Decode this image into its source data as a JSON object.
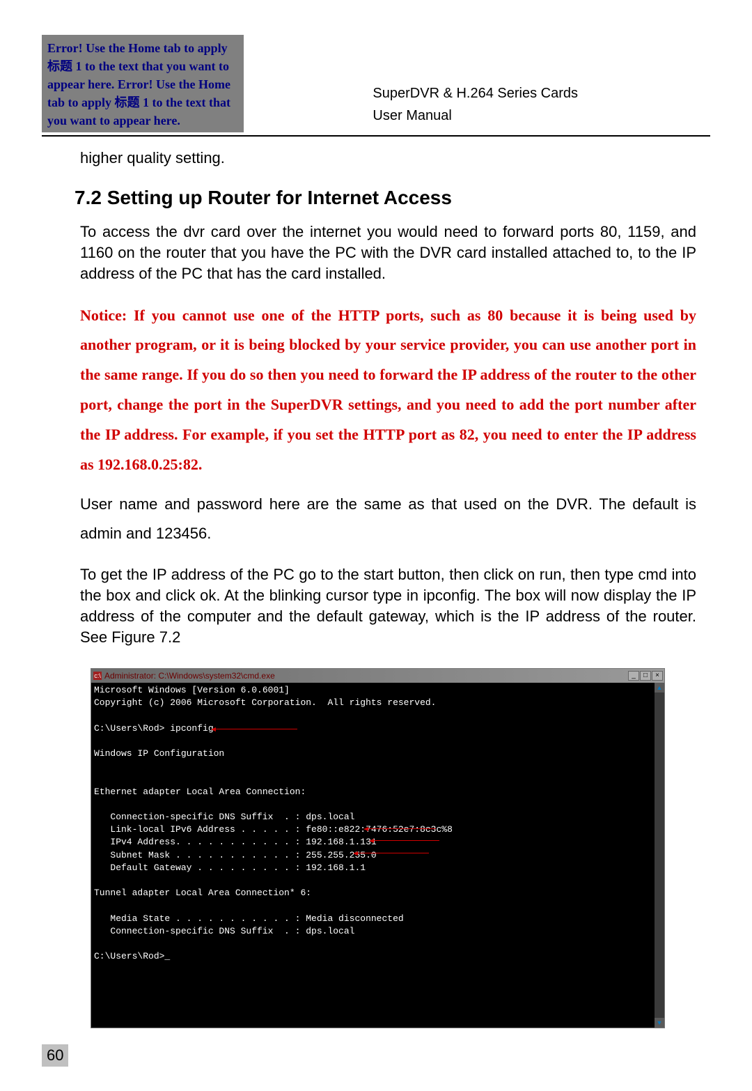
{
  "header": {
    "error_box": "Error! Use the Home tab to apply 标题 1 to the text that you want to appear here. Error! Use the Home tab to apply 标题 1 to the text that you want to appear here.",
    "right_line1": "SuperDVR & H.264 Series Cards",
    "right_line2": "User Manual"
  },
  "lead_in": "higher quality setting.",
  "section_heading": "7.2 Setting up Router for Internet Access",
  "para1": "To access the dvr card over the internet you would need to forward ports 80, 1159, and 1160 on the router that you have the PC with the DVR card installed attached to, to the IP address of the PC that has the card installed.",
  "notice": "Notice: If you cannot use one of the HTTP ports, such as 80 because it is being used by another program, or it is being blocked by your service provider, you can use another port in the same range. If you do so then you need to forward the IP address of the router to the other port, change the port in the SuperDVR settings, and you need to add the port number after the IP address. For example, if you set the HTTP port as 82, you need to enter the IP address as 192.168.0.25:82.",
  "para2": "User name and password here are the same as that used on the DVR. The default is admin and 123456.",
  "para3": "To get the IP address of the PC go to the start button, then click on run, then type cmd into the box and click ok. At the blinking cursor type in ipconfig. The box will now display the IP address of the computer and the default gateway, which is the IP address of the router. See Figure 7.2",
  "cmd": {
    "titlebar": "Administrator: C:\\Windows\\system32\\cmd.exe",
    "line1": "Microsoft Windows [Version 6.0.6001]",
    "line2": "Copyright (c) 2006 Microsoft Corporation.  All rights reserved.",
    "prompt1": "C:\\Users\\Rod> ipconfig",
    "heading": "Windows IP Configuration",
    "eth_header": "Ethernet adapter Local Area Connection:",
    "dns": "   Connection-specific DNS Suffix  . : dps.local",
    "ipv6": "   Link-local IPv6 Address . . . . . : fe80::e822:7476:52e7:8c3c%8",
    "ipv4": "   IPv4 Address. . . . . . . . . . . : 192.168.1.131",
    "subnet": "   Subnet Mask . . . . . . . . . . . : 255.255.255.0",
    "gw": "   Default Gateway . . . . . . . . . : 192.168.1.1",
    "tunnel_header": "Tunnel adapter Local Area Connection* 6:",
    "media": "   Media State . . . . . . . . . . . : Media disconnected",
    "dns2": "   Connection-specific DNS Suffix  . : dps.local",
    "prompt2": "C:\\Users\\Rod>_"
  },
  "page_number": "60"
}
